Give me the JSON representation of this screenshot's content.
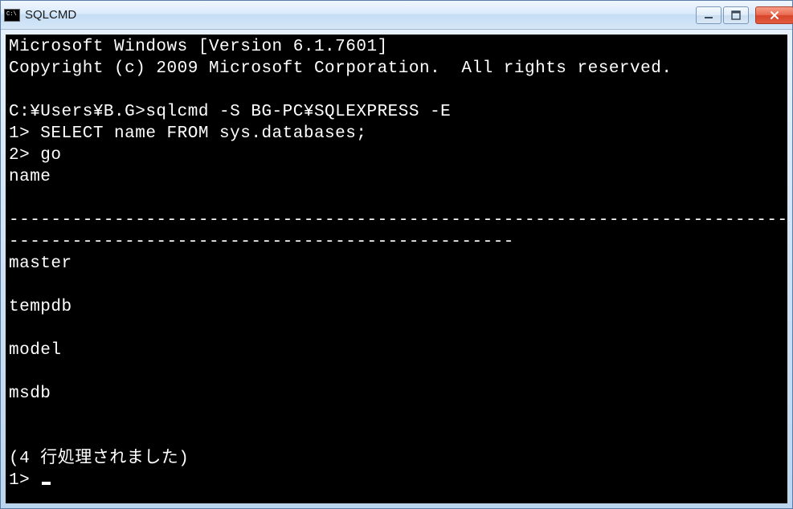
{
  "window": {
    "title": "SQLCMD"
  },
  "console": {
    "lines": {
      "l0": "Microsoft Windows [Version 6.1.7601]",
      "l1": "Copyright (c) 2009 Microsoft Corporation.  All rights reserved.",
      "l2": "",
      "l3": "C:¥Users¥B.G>sqlcmd -S BG-PC¥SQLEXPRESS -E",
      "l4": "1> SELECT name FROM sys.databases;",
      "l5": "2> go",
      "l6": "name",
      "l7": "",
      "l8": "--------------------------------------------------------------------------------",
      "l9": "------------------------------------------------",
      "l10": "master",
      "l11": "",
      "l12": "tempdb",
      "l13": "",
      "l14": "model",
      "l15": "",
      "l16": "msdb",
      "l17": "",
      "l18": "",
      "l19": "(4 行処理されました)",
      "l20": "1> "
    }
  }
}
